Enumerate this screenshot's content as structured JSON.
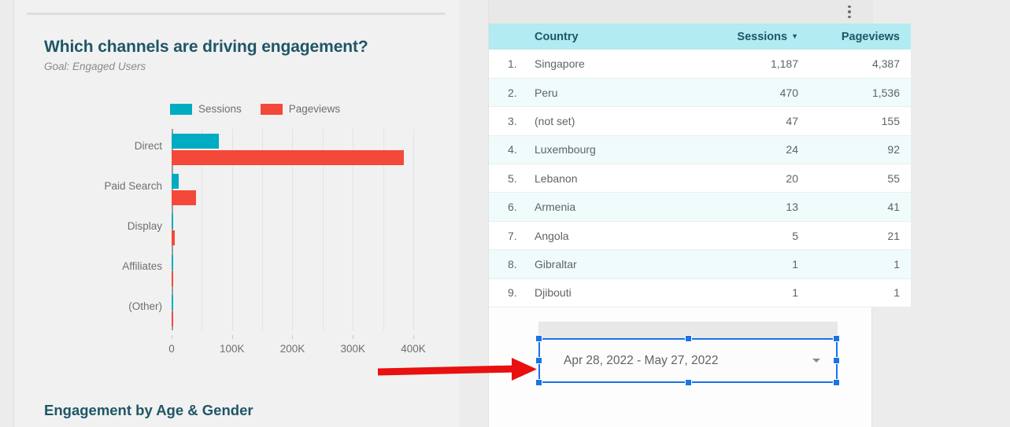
{
  "left_panel": {
    "title": "Which channels are driving engagement?",
    "subtitle": "Goal: Engaged Users",
    "section_title_2": "Engagement by Age & Gender"
  },
  "chart_data": {
    "type": "bar",
    "orientation": "horizontal",
    "title": "Which channels are driving engagement?",
    "subtitle": "Goal: Engaged Users",
    "xlabel": "",
    "ylabel": "",
    "categories": [
      "Direct",
      "Paid Search",
      "Display",
      "Affiliates",
      "(Other)"
    ],
    "series": [
      {
        "name": "Sessions",
        "color": "#00acc1",
        "values": [
          78000,
          12000,
          3000,
          300,
          200
        ]
      },
      {
        "name": "Pageviews",
        "color": "#f4483a",
        "values": [
          385000,
          40000,
          5000,
          400,
          300
        ]
      }
    ],
    "xlim": [
      0,
      430000
    ],
    "xticks": [
      0,
      100000,
      200000,
      300000,
      400000
    ],
    "xtick_labels": [
      "0",
      "100K",
      "200K",
      "300K",
      "400K"
    ],
    "grid": true,
    "legend_position": "top"
  },
  "right_panel": {
    "menu_icon": "kebab-menu-icon",
    "table": {
      "columns": [
        "Country",
        "Sessions",
        "Pageviews"
      ],
      "sort_column": "Sessions",
      "sort_direction": "descending",
      "sort_icon": "▼",
      "rows": [
        {
          "index": "1.",
          "country": "Singapore",
          "sessions": "1,187",
          "pageviews": "4,387"
        },
        {
          "index": "2.",
          "country": "Peru",
          "sessions": "470",
          "pageviews": "1,536"
        },
        {
          "index": "3.",
          "country": "(not set)",
          "sessions": "47",
          "pageviews": "155"
        },
        {
          "index": "4.",
          "country": "Luxembourg",
          "sessions": "24",
          "pageviews": "92"
        },
        {
          "index": "5.",
          "country": "Lebanon",
          "sessions": "20",
          "pageviews": "55"
        },
        {
          "index": "6.",
          "country": "Armenia",
          "sessions": "13",
          "pageviews": "41"
        },
        {
          "index": "7.",
          "country": "Angola",
          "sessions": "5",
          "pageviews": "21"
        },
        {
          "index": "8.",
          "country": "Gibraltar",
          "sessions": "1",
          "pageviews": "1"
        },
        {
          "index": "9.",
          "country": "Djibouti",
          "sessions": "1",
          "pageviews": "1"
        }
      ]
    }
  },
  "date_range_widget": {
    "value": "Apr 28, 2022 - May 27, 2022",
    "caret_icon": "chevron-down-icon",
    "selected": true,
    "selection_color": "#1a73e8"
  },
  "annotation": {
    "type": "arrow",
    "color": "#e81010",
    "direction": "right"
  },
  "colors": {
    "heading": "#1f5666",
    "sessions": "#00acc1",
    "pageviews": "#f4483a",
    "table_header_bg": "#b2ebf2",
    "row_alt_bg": "#effcfb",
    "canvas": "#ececec"
  }
}
